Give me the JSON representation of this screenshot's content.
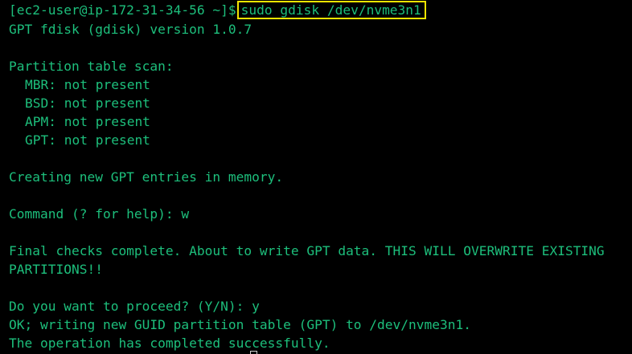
{
  "terminal": {
    "prompt": "[ec2-user@ip-172-31-34-56 ~]$",
    "command": "sudo gdisk /dev/nvme3n1",
    "version_line": "GPT fdisk (gdisk) version 1.0.7",
    "scan_header": "Partition table scan:",
    "scan_mbr": "MBR: not present",
    "scan_bsd": "BSD: not present",
    "scan_apm": "APM: not present",
    "scan_gpt": "GPT: not present",
    "creating_line": "Creating new GPT entries in memory.",
    "command_prompt_line": "Command (? for help): w",
    "final_checks_line1": "Final checks complete. About to write GPT data. THIS WILL OVERWRITE EXISTING",
    "final_checks_line2": "PARTITIONS!!",
    "proceed_line": "Do you want to proceed? (Y/N): y",
    "writing_line": "OK; writing new GUID partition table (GPT) to /dev/nvme3n1.",
    "completed_line": "The operation has completed successfully."
  },
  "colors": {
    "background": "#000000",
    "text": "#1dbf7c",
    "highlight_border": "#f2e400"
  }
}
